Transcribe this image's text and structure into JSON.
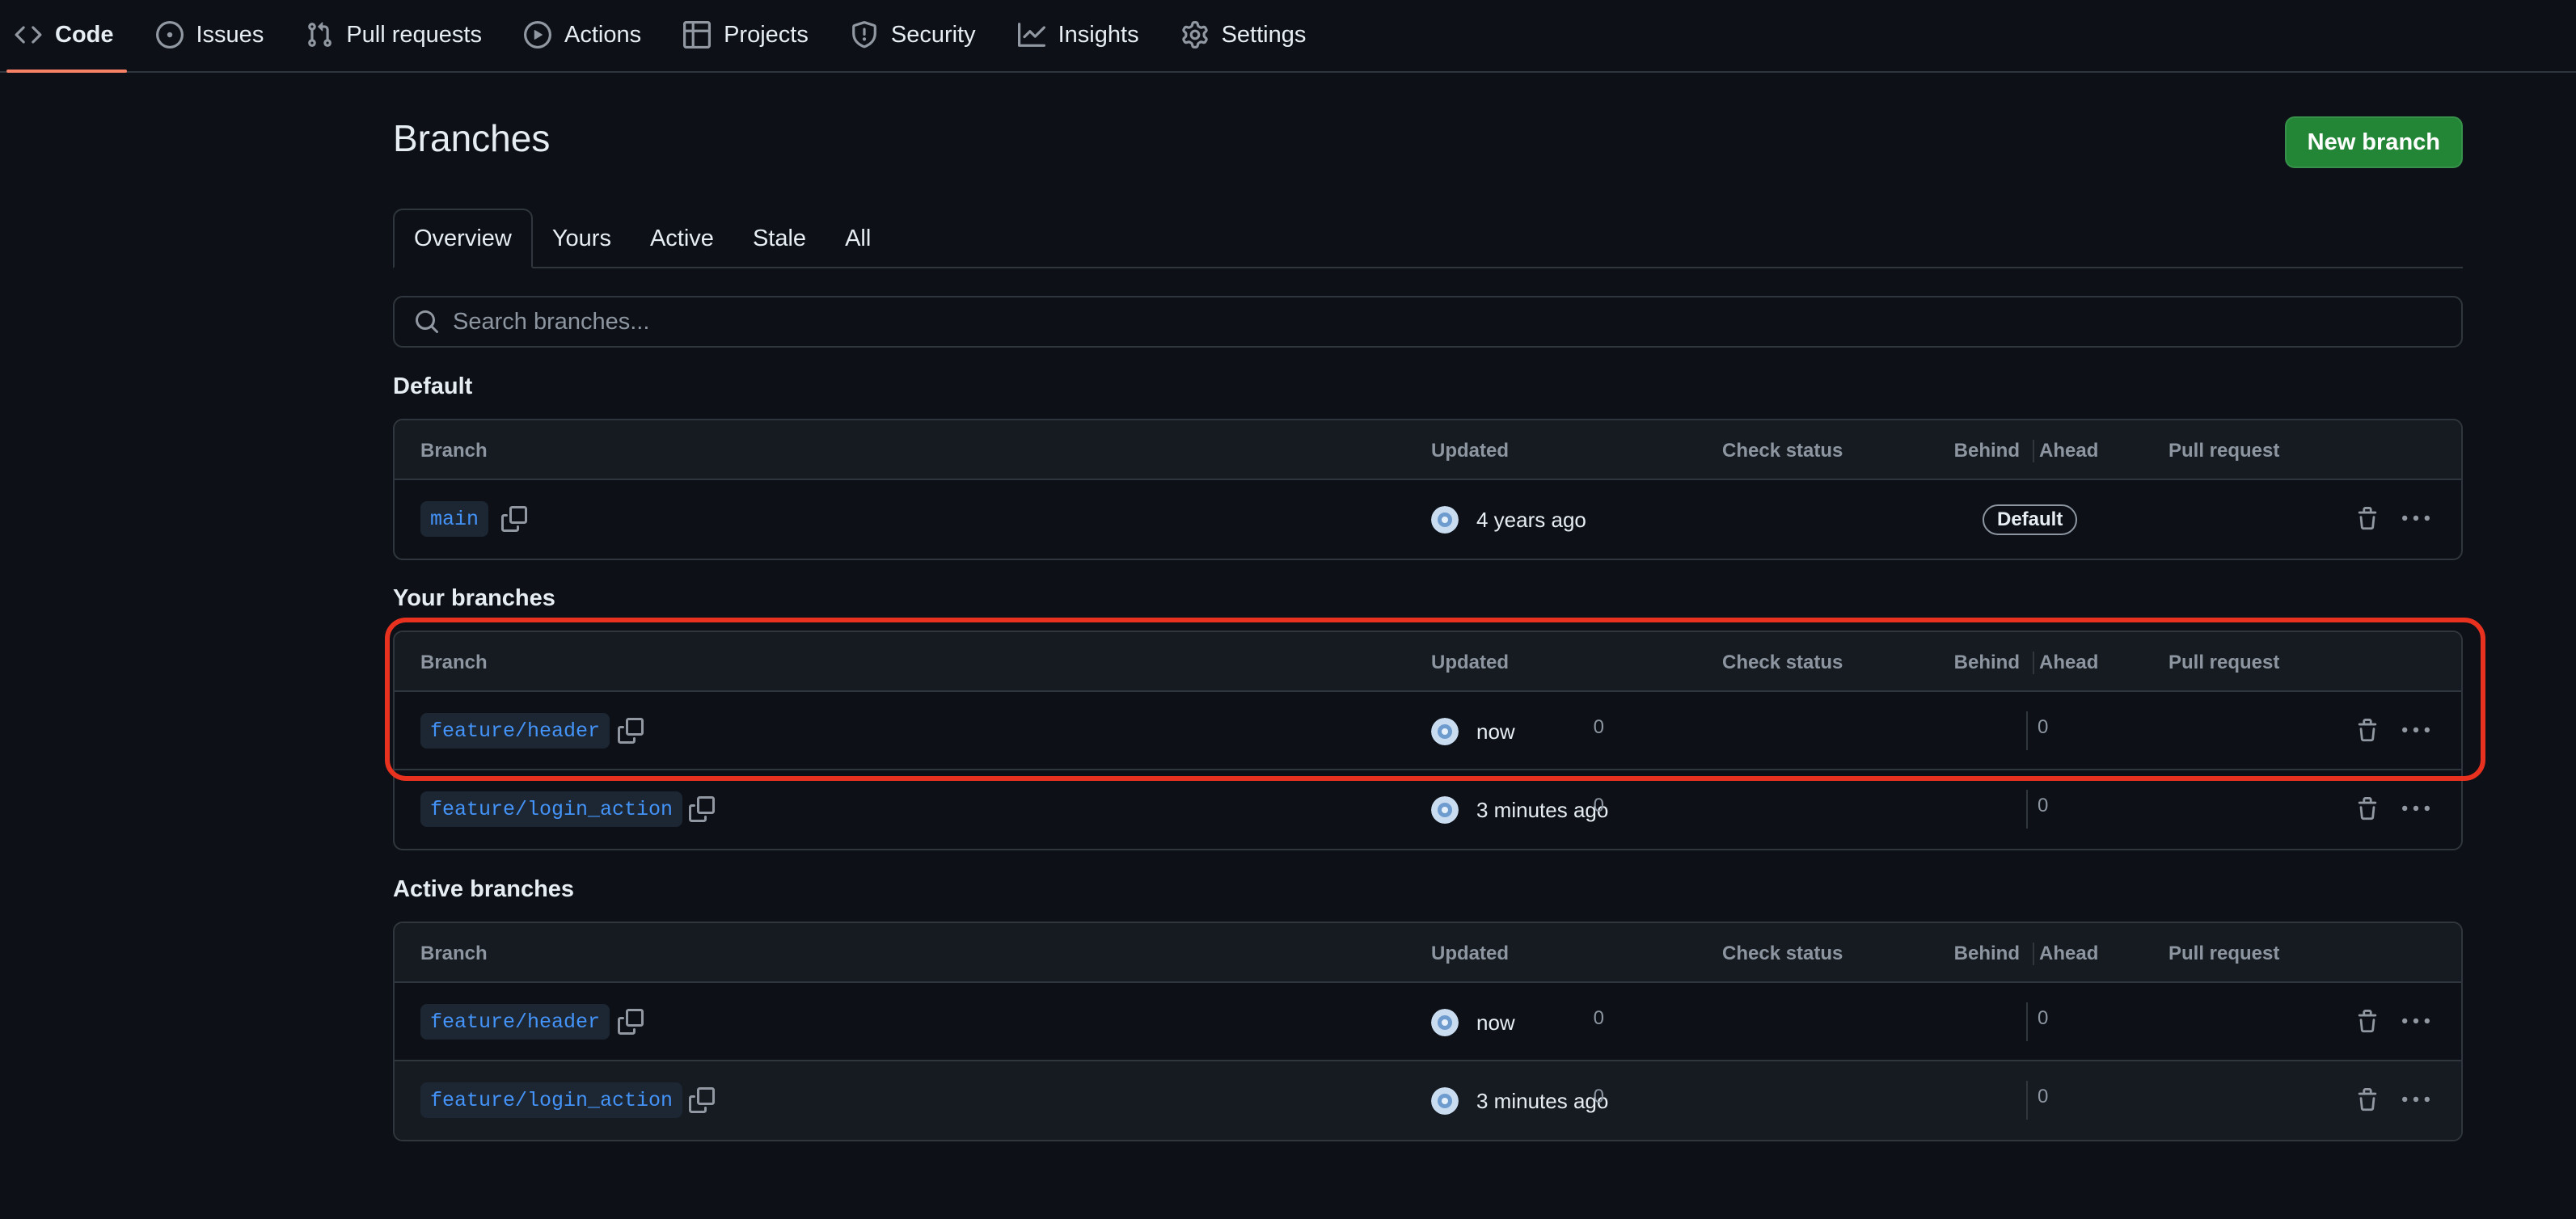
{
  "repo_nav": {
    "tabs": [
      {
        "label": "Code",
        "icon": "code-icon",
        "selected": true
      },
      {
        "label": "Issues",
        "icon": "issue-opened-icon"
      },
      {
        "label": "Pull requests",
        "icon": "git-pull-request-icon"
      },
      {
        "label": "Actions",
        "icon": "play-icon"
      },
      {
        "label": "Projects",
        "icon": "table-icon"
      },
      {
        "label": "Security",
        "icon": "shield-icon"
      },
      {
        "label": "Insights",
        "icon": "graph-icon"
      },
      {
        "label": "Settings",
        "icon": "gear-icon"
      }
    ]
  },
  "page": {
    "title": "Branches",
    "new_branch_label": "New branch",
    "subtabs": [
      "Overview",
      "Yours",
      "Active",
      "Stale",
      "All"
    ],
    "active_subtab": "Overview",
    "search_placeholder": "Search branches..."
  },
  "columns": {
    "branch": "Branch",
    "updated": "Updated",
    "check_status": "Check status",
    "behind": "Behind",
    "ahead": "Ahead",
    "pull_request": "Pull request"
  },
  "sections": {
    "default": {
      "title": "Default",
      "rows": [
        {
          "branch": "main",
          "updated": "4 years ago",
          "badge": "Default"
        }
      ]
    },
    "yours": {
      "title": "Your branches",
      "rows": [
        {
          "branch": "feature/header",
          "updated": "now",
          "behind": "0",
          "ahead": "0"
        },
        {
          "branch": "feature/login_action",
          "updated": "3 minutes ago",
          "behind": "0",
          "ahead": "0"
        }
      ]
    },
    "active": {
      "title": "Active branches",
      "rows": [
        {
          "branch": "feature/header",
          "updated": "now",
          "behind": "0",
          "ahead": "0"
        },
        {
          "branch": "feature/login_action",
          "updated": "3 minutes ago",
          "behind": "0",
          "ahead": "0"
        }
      ]
    }
  },
  "colors": {
    "background": "#0d1117",
    "header_bg": "#161b22",
    "border": "#30363d",
    "accent_tab": "#f78166",
    "primary_button": "#238636",
    "branch_link": "#4493f8",
    "highlight_box": "#e8321f"
  }
}
